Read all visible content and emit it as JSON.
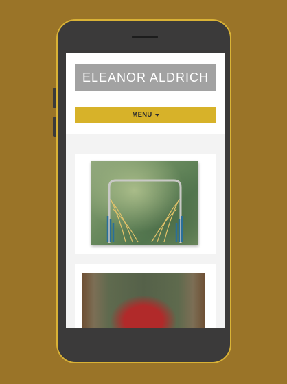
{
  "site": {
    "title": "ELEANOR ALDRICH",
    "menu_label": "MENU"
  },
  "colors": {
    "backdrop": "#9a7428",
    "phone_frame": "#3b3a3a",
    "phone_border": "#d9b236",
    "title_bar": "#a2a2a2",
    "menu_bar": "#d7b229"
  }
}
